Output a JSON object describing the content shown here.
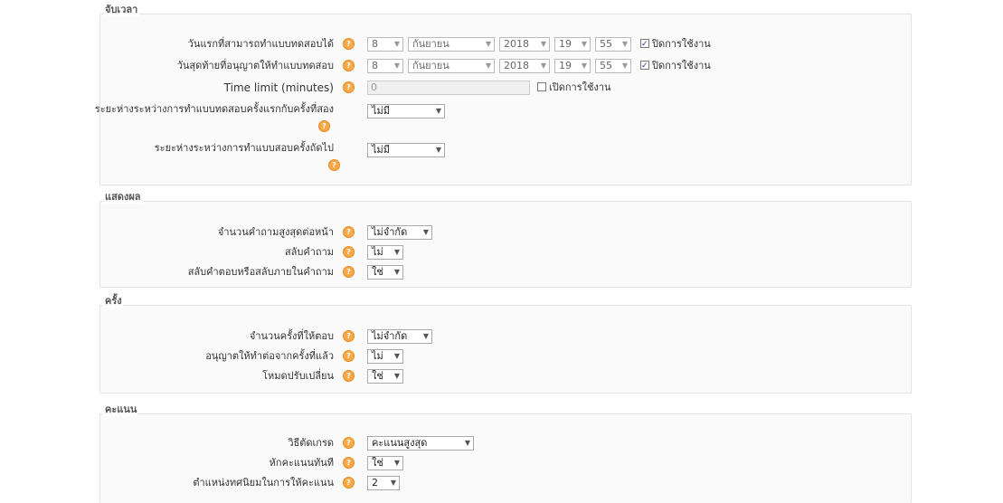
{
  "timing": {
    "legend": "จับเวลา",
    "open_label": "วันแรกที่สามารถทำแบบทดสอบได้",
    "close_label": "วันสุดท้ายที่อนุญาตให้ทำแบบทดสอบ",
    "open": {
      "day": "8",
      "month": "กันยายน",
      "year": "2018",
      "hour": "19",
      "minute": "55",
      "enable": "ปิดการใช้งาน"
    },
    "close": {
      "day": "8",
      "month": "กันยายน",
      "year": "2018",
      "hour": "19",
      "minute": "55",
      "enable": "ปิดการใช้งาน"
    },
    "timelimit_label": "Time limit (minutes)",
    "timelimit_value": "0",
    "timelimit_enable": "เปิดการใช้งาน",
    "delay1_label": "ระยะห่างระหว่างการทำแบบทดสอบครั้งแรกกับครั้งที่สอง",
    "delay1_value": "ไม่มี",
    "delay2_label": "ระยะห่างระหว่างการทำแบบสอบครั้งถัดไป",
    "delay2_value": "ไม่มี"
  },
  "display": {
    "legend": "แสดงผล",
    "qpp_label": "จำนวนคำถามสูงสุดต่อหน้า",
    "qpp_value": "ไม่จำกัด",
    "shuffleq_label": "สลับคำถาม",
    "shuffleq_value": "ไม่",
    "shufflea_label": "สลับคำตอบหรือสลับภายในคำถาม",
    "shufflea_value": "ใช่"
  },
  "attempts": {
    "legend": "ครั้ง",
    "count_label": "จำนวนครั้งที่ให้ตอบ",
    "count_value": "ไม่จำกัด",
    "build_label": "อนุญาตให้ทำต่อจากครั้งที่แล้ว",
    "build_value": "ไม่",
    "adaptive_label": "โหมดปรับเปลี่ยน",
    "adaptive_value": "ใช่"
  },
  "grades": {
    "legend": "คะแนน",
    "method_label": "วิธีตัดเกรด",
    "method_value": "คะแนนสูงสุด",
    "penalty_label": "หักคะแนนทันที",
    "penalty_value": "ใช่",
    "decimal_label": "ตำแหน่งทศนิยมในการให้คะแนน",
    "decimal_value": "2"
  },
  "icons": {
    "help": "help-icon",
    "dropdown": "chevron-down-icon",
    "checkbox": "checkbox-icon"
  },
  "colors": {
    "help_icon": "#f6a94a",
    "section_bg": "#fafafa",
    "checkbox_mark": "#1a3fa8"
  }
}
